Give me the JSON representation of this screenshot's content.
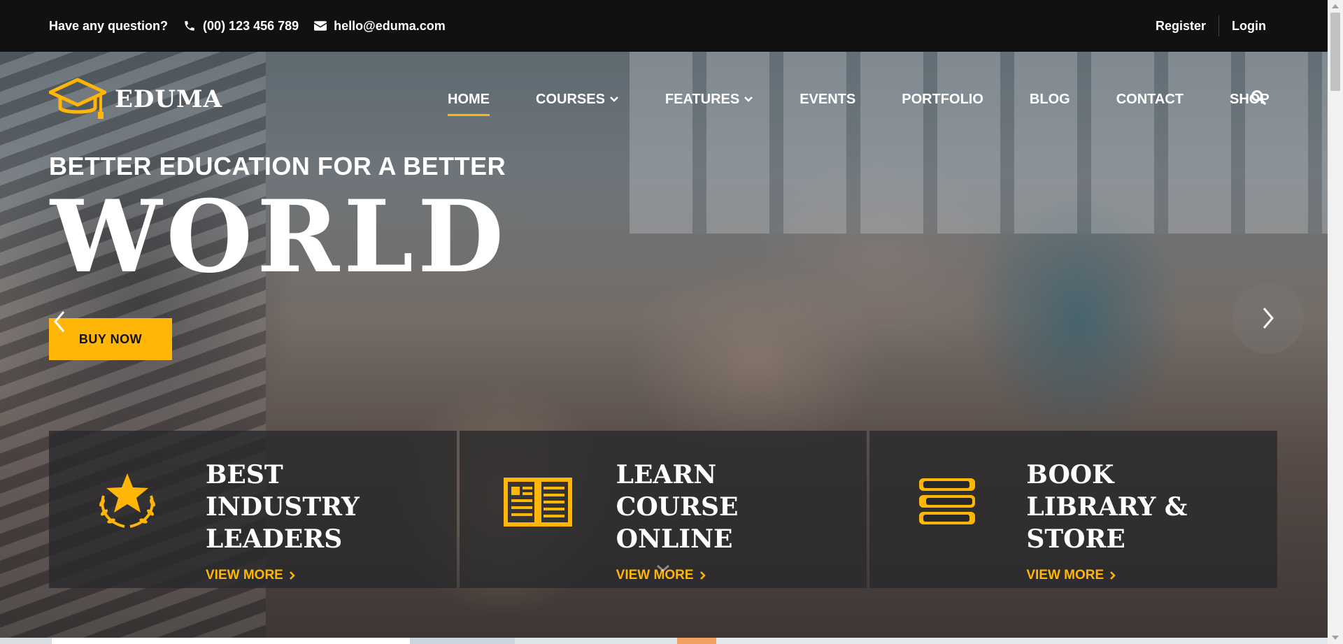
{
  "topbar": {
    "question": "Have any question?",
    "phone": "(00) 123 456 789",
    "email": "hello@eduma.com",
    "register": "Register",
    "login": "Login"
  },
  "logo": {
    "text": "EDUMA",
    "icon": "graduation-cap-icon"
  },
  "nav": {
    "items": [
      {
        "label": "HOME",
        "active": true
      },
      {
        "label": "COURSES",
        "dropdown": true
      },
      {
        "label": "FEATURES",
        "dropdown": true
      },
      {
        "label": "EVENTS"
      },
      {
        "label": "PORTFOLIO"
      },
      {
        "label": "BLOG"
      },
      {
        "label": "CONTACT"
      },
      {
        "label": "SHOP"
      }
    ],
    "search_icon": "search-icon"
  },
  "hero": {
    "subtitle": "BETTER EDUCATION FOR A BETTER",
    "title": "WORLD",
    "button": "BUY NOW"
  },
  "features": [
    {
      "title": "BEST INDUSTRY LEADERS",
      "more": "VIEW MORE",
      "icon": "laurel-star-icon"
    },
    {
      "title": "LEARN COURSE ONLINE",
      "more": "VIEW MORE",
      "icon": "open-book-icon"
    },
    {
      "title": "BOOK LIBRARY & STORE",
      "more": "VIEW MORE",
      "icon": "book-stack-icon"
    }
  ],
  "colors": {
    "accent": "#ffb606",
    "topbar": "#111111",
    "feature_bg": "#28282a"
  }
}
